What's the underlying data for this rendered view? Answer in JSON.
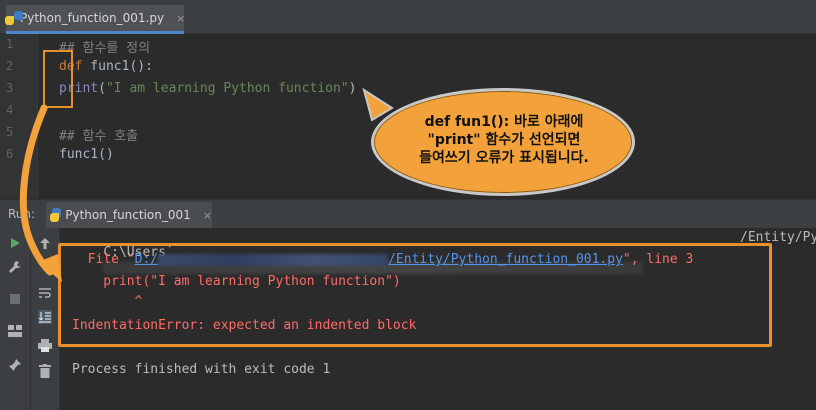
{
  "editor": {
    "tab_title": "Python_function_001.py",
    "tab_close": "×",
    "line_numbers": [
      "1",
      "2",
      "3",
      "4",
      "5",
      "6"
    ],
    "lines": {
      "l1": "## 함수를 정의",
      "l2_kw": "def",
      "l2_name": " func1",
      "l2_rest": "():",
      "l3_builtin": "print",
      "l3_open": "(",
      "l3_str": "\"I am learning Python function\"",
      "l3_close": ")",
      "l5": "## 함수 호출",
      "l6": "func1()"
    }
  },
  "run_panel": {
    "label": "Run:",
    "tab_title": "Python_function_001",
    "tab_close": "×",
    "tools": [
      "play-icon",
      "up-arrow-icon",
      "wrench-icon",
      "wrap-icon",
      "stop-icon",
      "scroll-end-icon",
      "layout-icon",
      "print-icon",
      "pin-icon",
      "trash-icon"
    ]
  },
  "console": {
    "path_prefix": "C:\\Users`",
    "path_suffix": "/Entity/Py",
    "file_prefix": "  File \"",
    "file_link_start": "D:/",
    "file_link_end": "/Entity/Python_function_001.py",
    "file_suffix": "\", line 3",
    "code_echo": "    print(\"I am learning Python function\")",
    "caret": "        ^",
    "error": "IndentationError: expected an indented block",
    "finished": "Process finished with exit code 1"
  },
  "callout": {
    "line1": "def fun1(): 바로 아래에",
    "line2": "\"print\" 함수가 선언되면",
    "line3": "들여쓰기 오류가 표시됩니다."
  },
  "colors": {
    "annotation_orange": "#e8902d",
    "callout_fill": "#f3a13a",
    "error_red": "#ff6b68",
    "link_blue": "#5394ec"
  }
}
